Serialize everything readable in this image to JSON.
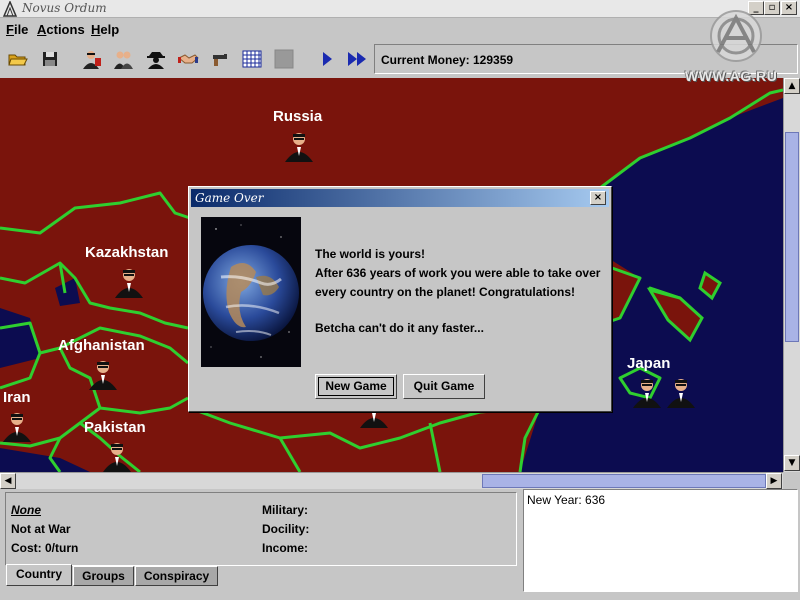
{
  "window": {
    "title": "Novus Ordum"
  },
  "menubar": {
    "items": [
      {
        "first": "F",
        "rest": "ile"
      },
      {
        "first": "A",
        "rest": "ctions"
      },
      {
        "first": "H",
        "rest": "elp"
      }
    ]
  },
  "toolbar": {
    "icons": [
      "open-folder-icon",
      "save-disk-icon",
      "agent-red-icon",
      "agent-group-icon",
      "spy-icon",
      "handshake-icon",
      "gun-icon",
      "grid-icon",
      "disabled-icon",
      "play-icon",
      "fast-forward-icon"
    ],
    "money_label": "Current Money: 129359"
  },
  "map": {
    "countries": [
      {
        "name": "Russia"
      },
      {
        "name": "Kazakhstan"
      },
      {
        "name": "Afghanistan"
      },
      {
        "name": "Iran"
      },
      {
        "name": "Pakistan"
      },
      {
        "name": "Japan"
      }
    ],
    "colors": {
      "owned": "#7a140c",
      "sea": "#0c0c50",
      "border": "#2fcf2f"
    }
  },
  "dialog": {
    "title": "Game Over",
    "line1": "The world is yours!",
    "line2": "After 636 years of work you were able to take over",
    "line3": "every country on the planet! Congratulations!",
    "line4": "Betcha can't do it any faster...",
    "new_game": "New Game",
    "quit_game": "Quit Game"
  },
  "info": {
    "country": "None",
    "war_status": "Not at War",
    "cost": "Cost: 0/turn",
    "military": "Military:",
    "docility": "Docility:",
    "income": "Income:"
  },
  "tabs": [
    "Country",
    "Groups",
    "Conspiracy"
  ],
  "log": {
    "text": "New Year: 636"
  },
  "watermark": {
    "url": "WWW.AG.RU"
  }
}
